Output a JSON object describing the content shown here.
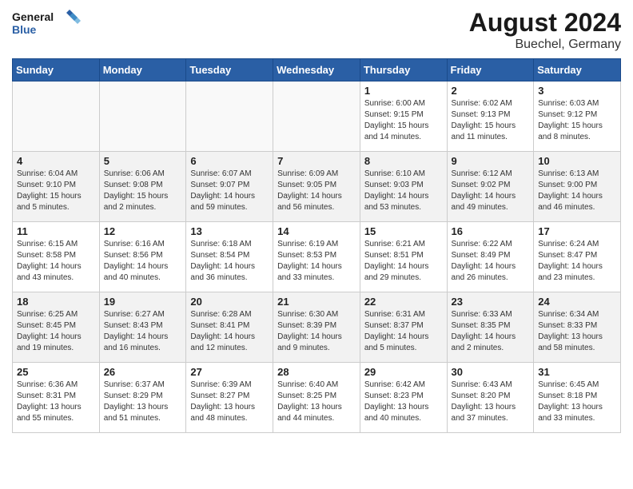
{
  "header": {
    "logo_general": "General",
    "logo_blue": "Blue",
    "month_year": "August 2024",
    "location": "Buechel, Germany"
  },
  "days_of_week": [
    "Sunday",
    "Monday",
    "Tuesday",
    "Wednesday",
    "Thursday",
    "Friday",
    "Saturday"
  ],
  "weeks": [
    [
      {
        "day": "",
        "info": "",
        "empty": true
      },
      {
        "day": "",
        "info": "",
        "empty": true
      },
      {
        "day": "",
        "info": "",
        "empty": true
      },
      {
        "day": "",
        "info": "",
        "empty": true
      },
      {
        "day": "1",
        "info": "Sunrise: 6:00 AM\nSunset: 9:15 PM\nDaylight: 15 hours\nand 14 minutes.",
        "empty": false
      },
      {
        "day": "2",
        "info": "Sunrise: 6:02 AM\nSunset: 9:13 PM\nDaylight: 15 hours\nand 11 minutes.",
        "empty": false
      },
      {
        "day": "3",
        "info": "Sunrise: 6:03 AM\nSunset: 9:12 PM\nDaylight: 15 hours\nand 8 minutes.",
        "empty": false
      }
    ],
    [
      {
        "day": "4",
        "info": "Sunrise: 6:04 AM\nSunset: 9:10 PM\nDaylight: 15 hours\nand 5 minutes.",
        "empty": false
      },
      {
        "day": "5",
        "info": "Sunrise: 6:06 AM\nSunset: 9:08 PM\nDaylight: 15 hours\nand 2 minutes.",
        "empty": false
      },
      {
        "day": "6",
        "info": "Sunrise: 6:07 AM\nSunset: 9:07 PM\nDaylight: 14 hours\nand 59 minutes.",
        "empty": false
      },
      {
        "day": "7",
        "info": "Sunrise: 6:09 AM\nSunset: 9:05 PM\nDaylight: 14 hours\nand 56 minutes.",
        "empty": false
      },
      {
        "day": "8",
        "info": "Sunrise: 6:10 AM\nSunset: 9:03 PM\nDaylight: 14 hours\nand 53 minutes.",
        "empty": false
      },
      {
        "day": "9",
        "info": "Sunrise: 6:12 AM\nSunset: 9:02 PM\nDaylight: 14 hours\nand 49 minutes.",
        "empty": false
      },
      {
        "day": "10",
        "info": "Sunrise: 6:13 AM\nSunset: 9:00 PM\nDaylight: 14 hours\nand 46 minutes.",
        "empty": false
      }
    ],
    [
      {
        "day": "11",
        "info": "Sunrise: 6:15 AM\nSunset: 8:58 PM\nDaylight: 14 hours\nand 43 minutes.",
        "empty": false
      },
      {
        "day": "12",
        "info": "Sunrise: 6:16 AM\nSunset: 8:56 PM\nDaylight: 14 hours\nand 40 minutes.",
        "empty": false
      },
      {
        "day": "13",
        "info": "Sunrise: 6:18 AM\nSunset: 8:54 PM\nDaylight: 14 hours\nand 36 minutes.",
        "empty": false
      },
      {
        "day": "14",
        "info": "Sunrise: 6:19 AM\nSunset: 8:53 PM\nDaylight: 14 hours\nand 33 minutes.",
        "empty": false
      },
      {
        "day": "15",
        "info": "Sunrise: 6:21 AM\nSunset: 8:51 PM\nDaylight: 14 hours\nand 29 minutes.",
        "empty": false
      },
      {
        "day": "16",
        "info": "Sunrise: 6:22 AM\nSunset: 8:49 PM\nDaylight: 14 hours\nand 26 minutes.",
        "empty": false
      },
      {
        "day": "17",
        "info": "Sunrise: 6:24 AM\nSunset: 8:47 PM\nDaylight: 14 hours\nand 23 minutes.",
        "empty": false
      }
    ],
    [
      {
        "day": "18",
        "info": "Sunrise: 6:25 AM\nSunset: 8:45 PM\nDaylight: 14 hours\nand 19 minutes.",
        "empty": false
      },
      {
        "day": "19",
        "info": "Sunrise: 6:27 AM\nSunset: 8:43 PM\nDaylight: 14 hours\nand 16 minutes.",
        "empty": false
      },
      {
        "day": "20",
        "info": "Sunrise: 6:28 AM\nSunset: 8:41 PM\nDaylight: 14 hours\nand 12 minutes.",
        "empty": false
      },
      {
        "day": "21",
        "info": "Sunrise: 6:30 AM\nSunset: 8:39 PM\nDaylight: 14 hours\nand 9 minutes.",
        "empty": false
      },
      {
        "day": "22",
        "info": "Sunrise: 6:31 AM\nSunset: 8:37 PM\nDaylight: 14 hours\nand 5 minutes.",
        "empty": false
      },
      {
        "day": "23",
        "info": "Sunrise: 6:33 AM\nSunset: 8:35 PM\nDaylight: 14 hours\nand 2 minutes.",
        "empty": false
      },
      {
        "day": "24",
        "info": "Sunrise: 6:34 AM\nSunset: 8:33 PM\nDaylight: 13 hours\nand 58 minutes.",
        "empty": false
      }
    ],
    [
      {
        "day": "25",
        "info": "Sunrise: 6:36 AM\nSunset: 8:31 PM\nDaylight: 13 hours\nand 55 minutes.",
        "empty": false
      },
      {
        "day": "26",
        "info": "Sunrise: 6:37 AM\nSunset: 8:29 PM\nDaylight: 13 hours\nand 51 minutes.",
        "empty": false
      },
      {
        "day": "27",
        "info": "Sunrise: 6:39 AM\nSunset: 8:27 PM\nDaylight: 13 hours\nand 48 minutes.",
        "empty": false
      },
      {
        "day": "28",
        "info": "Sunrise: 6:40 AM\nSunset: 8:25 PM\nDaylight: 13 hours\nand 44 minutes.",
        "empty": false
      },
      {
        "day": "29",
        "info": "Sunrise: 6:42 AM\nSunset: 8:23 PM\nDaylight: 13 hours\nand 40 minutes.",
        "empty": false
      },
      {
        "day": "30",
        "info": "Sunrise: 6:43 AM\nSunset: 8:20 PM\nDaylight: 13 hours\nand 37 minutes.",
        "empty": false
      },
      {
        "day": "31",
        "info": "Sunrise: 6:45 AM\nSunset: 8:18 PM\nDaylight: 13 hours\nand 33 minutes.",
        "empty": false
      }
    ]
  ]
}
